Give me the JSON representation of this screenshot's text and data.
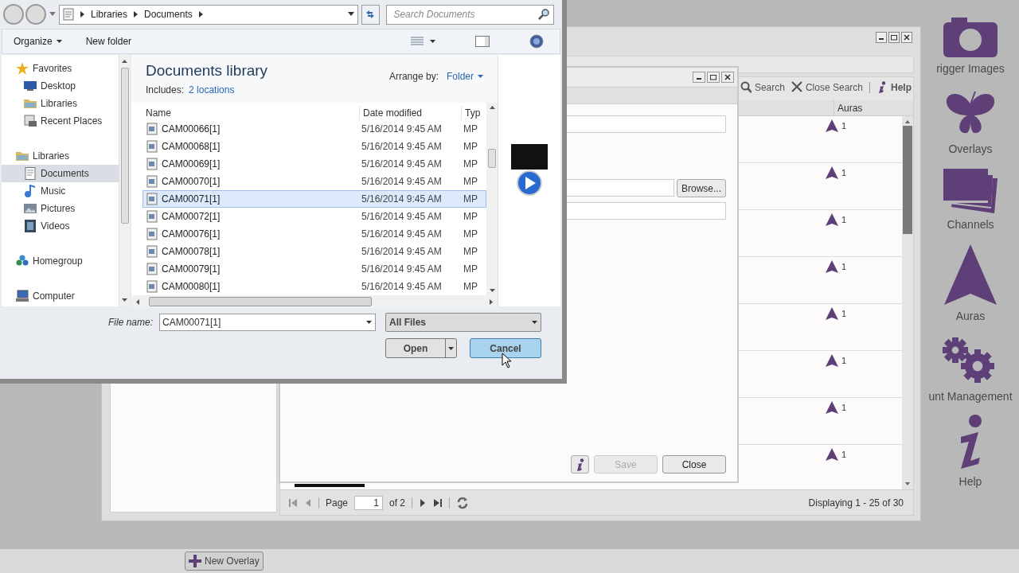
{
  "sidebar": [
    {
      "label": "rigger Images",
      "kind": "camera"
    },
    {
      "label": "Overlays",
      "kind": "butterfly"
    },
    {
      "label": "Channels",
      "kind": "stack"
    },
    {
      "label": "Auras",
      "kind": "aura"
    },
    {
      "label": "unt Management",
      "kind": "gears"
    },
    {
      "label": "Help",
      "kind": "info"
    }
  ],
  "bottom_bar": {
    "new_overlay": "New Overlay"
  },
  "main_window": {
    "toolbar": [
      {
        "label": "Search",
        "kind": "search"
      },
      {
        "label": "Close Search",
        "kind": "close"
      },
      {
        "label": "Help",
        "kind": "help"
      }
    ],
    "columns": [
      "Auras"
    ],
    "rows": [
      {
        "auras": "1"
      },
      {
        "auras": "1"
      },
      {
        "auras": "1"
      },
      {
        "auras": "1"
      },
      {
        "auras": "1"
      },
      {
        "auras": "1"
      },
      {
        "auras": "1"
      },
      {
        "auras": "1"
      }
    ],
    "pager": {
      "page_label": "Page",
      "page_value": "1",
      "of_label": "of 2"
    },
    "display_status": "Displaying 1 - 25 of 30"
  },
  "overlay_dialog": {
    "browse_button": "Browse...",
    "buttons": [
      {
        "label": "Save",
        "disabled": true
      },
      {
        "label": "Close",
        "disabled": false
      }
    ]
  },
  "file_dialog": {
    "breadcrumbs": [
      "Libraries",
      "Documents"
    ],
    "search_placeholder": "Search Documents",
    "toolbar": [
      "Organize",
      "New folder"
    ],
    "nav": [
      {
        "label": "Favorites",
        "kind": "star",
        "selected": false,
        "children": [
          {
            "label": "Desktop",
            "kind": "desktop",
            "selected": false
          },
          {
            "label": "Libraries",
            "kind": "folder",
            "selected": false
          },
          {
            "label": "Recent Places",
            "kind": "recent",
            "selected": false
          }
        ]
      },
      {
        "label": "Libraries",
        "kind": "folder",
        "selected": false,
        "children": [
          {
            "label": "Documents",
            "kind": "document",
            "selected": true
          },
          {
            "label": "Music",
            "kind": "music",
            "selected": false
          },
          {
            "label": "Pictures",
            "kind": "picture",
            "selected": false
          },
          {
            "label": "Videos",
            "kind": "video",
            "selected": false
          }
        ]
      },
      {
        "label": "Homegroup",
        "kind": "homegroup",
        "selected": false
      },
      {
        "label": "Computer",
        "kind": "computer",
        "selected": false
      }
    ],
    "library_title": "Documents library",
    "includes_label": "Includes:",
    "includes_link": "2 locations",
    "arrange_label": "Arrange by:",
    "arrange_value": "Folder",
    "columns": [
      "Name",
      "Date modified",
      "Typ"
    ],
    "files": [
      {
        "name": "CAM00066[1]",
        "date": "5/16/2014 9:45 AM",
        "type": "MP",
        "selected": false
      },
      {
        "name": "CAM00068[1]",
        "date": "5/16/2014 9:45 AM",
        "type": "MP",
        "selected": false
      },
      {
        "name": "CAM00069[1]",
        "date": "5/16/2014 9:45 AM",
        "type": "MP",
        "selected": false
      },
      {
        "name": "CAM00070[1]",
        "date": "5/16/2014 9:45 AM",
        "type": "MP",
        "selected": false
      },
      {
        "name": "CAM00071[1]",
        "date": "5/16/2014 9:45 AM",
        "type": "MP",
        "selected": true
      },
      {
        "name": "CAM00072[1]",
        "date": "5/16/2014 9:45 AM",
        "type": "MP",
        "selected": false
      },
      {
        "name": "CAM00076[1]",
        "date": "5/16/2014 9:45 AM",
        "type": "MP",
        "selected": false
      },
      {
        "name": "CAM00078[1]",
        "date": "5/16/2014 9:45 AM",
        "type": "MP",
        "selected": false
      },
      {
        "name": "CAM00079[1]",
        "date": "5/16/2014 9:45 AM",
        "type": "MP",
        "selected": false
      },
      {
        "name": "CAM00080[1]",
        "date": "5/16/2014 9:45 AM",
        "type": "MP",
        "selected": false
      }
    ],
    "file_name_label": "File name:",
    "file_name_value": "CAM00071[1]",
    "filter": "All Files",
    "buttons": [
      {
        "label": "Open",
        "kind": "split"
      },
      {
        "label": "Cancel",
        "kind": "default"
      }
    ]
  }
}
